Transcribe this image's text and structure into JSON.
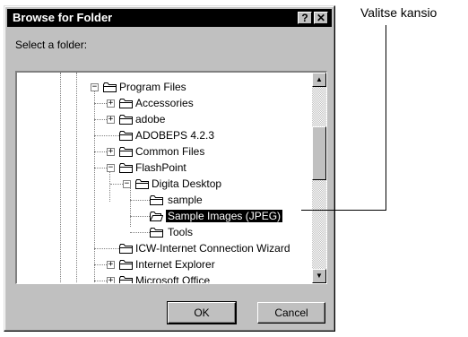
{
  "dialog": {
    "title": "Browse for Folder",
    "help_label": "?",
    "close_label": "✕",
    "prompt": "Select a folder:",
    "ok_label": "OK",
    "cancel_label": "Cancel"
  },
  "tree": {
    "nodes": [
      {
        "label": "Program Files",
        "expander": "−"
      },
      {
        "label": "Accessories",
        "expander": "+"
      },
      {
        "label": "adobe",
        "expander": "+"
      },
      {
        "label": "ADOBEPS 4.2.3",
        "expander": ""
      },
      {
        "label": "Common Files",
        "expander": "+"
      },
      {
        "label": "FlashPoint",
        "expander": "−"
      },
      {
        "label": "Digita Desktop",
        "expander": "−"
      },
      {
        "label": "sample",
        "expander": ""
      },
      {
        "label": "Sample Images (JPEG)",
        "expander": "",
        "selected": true
      },
      {
        "label": "Tools",
        "expander": ""
      },
      {
        "label": "ICW-Internet Connection Wizard",
        "expander": ""
      },
      {
        "label": "Internet Explorer",
        "expander": "+"
      },
      {
        "label": "Microsoft Office",
        "expander": "+"
      }
    ],
    "scroll_up": "▲",
    "scroll_down": "▼"
  },
  "callout": {
    "text": "Valitse kansio"
  },
  "colors": {
    "dialog_face": "#c0c0c0",
    "titlebar": "#000000",
    "selection": "#000000"
  }
}
